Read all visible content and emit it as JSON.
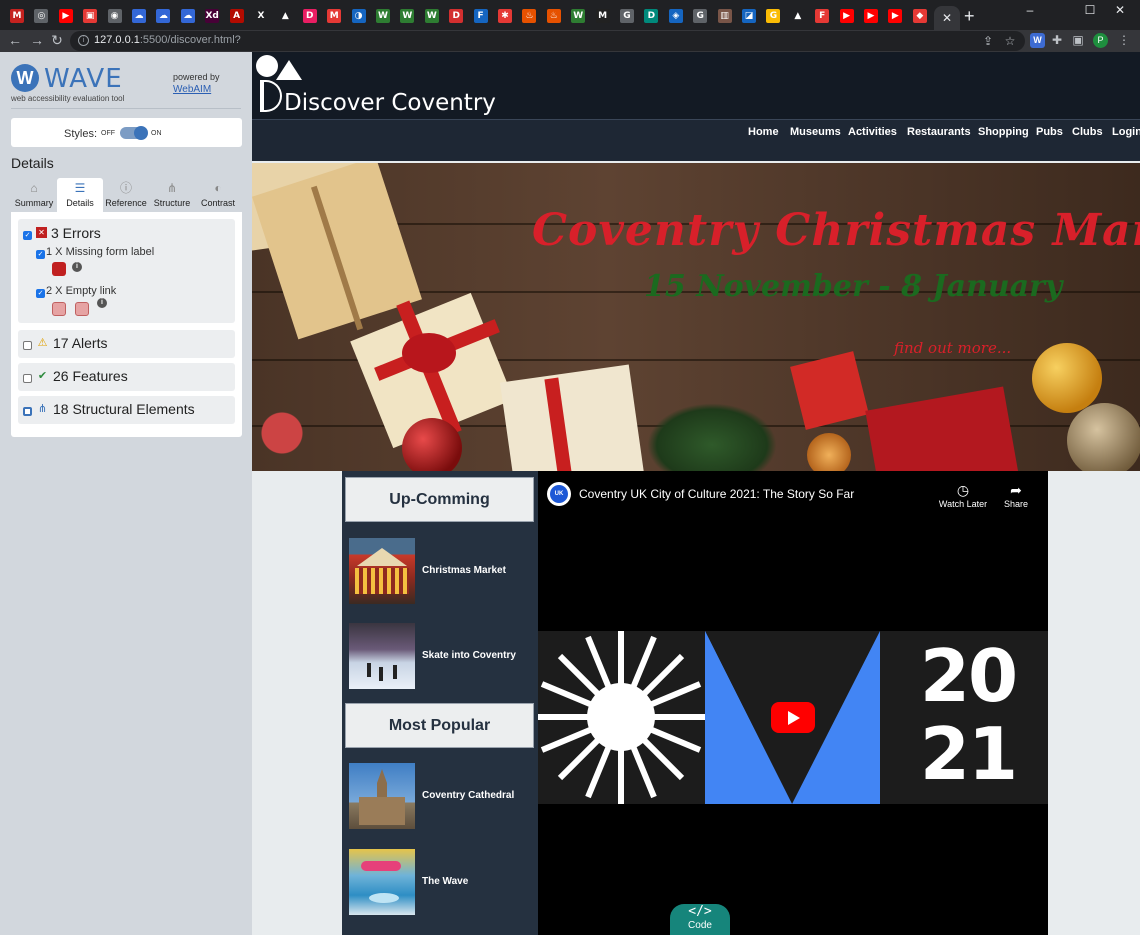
{
  "browser": {
    "url_host": "127.0.0.1",
    "url_path": ":5500/discover.html?",
    "tab_favicons": [
      {
        "glyph": "M",
        "color": "#c5221f"
      },
      {
        "glyph": "◎",
        "color": "#5f6368"
      },
      {
        "glyph": "▶",
        "color": "#ff0000"
      },
      {
        "glyph": "▣",
        "color": "#e53935"
      },
      {
        "glyph": "◉",
        "color": "#5f6368"
      },
      {
        "glyph": "☁",
        "color": "#3367d6"
      },
      {
        "glyph": "☁",
        "color": "#3367d6"
      },
      {
        "glyph": "☁",
        "color": "#3367d6"
      },
      {
        "glyph": "Xd",
        "color": "#470137"
      },
      {
        "glyph": "A",
        "color": "#b30b00"
      },
      {
        "glyph": "X",
        "color": "#202124"
      },
      {
        "glyph": "▲",
        "color": "#202124"
      },
      {
        "glyph": "D",
        "color": "#e91e63"
      },
      {
        "glyph": "M",
        "color": "#e53935"
      },
      {
        "glyph": "◑",
        "color": "#1565c0"
      },
      {
        "glyph": "W",
        "color": "#2e7d32"
      },
      {
        "glyph": "W",
        "color": "#2e7d32"
      },
      {
        "glyph": "W",
        "color": "#2e7d32"
      },
      {
        "glyph": "D",
        "color": "#d32f2f"
      },
      {
        "glyph": "F",
        "color": "#1565c0"
      },
      {
        "glyph": "✱",
        "color": "#e53935"
      },
      {
        "glyph": "♨",
        "color": "#e65100"
      },
      {
        "glyph": "♨",
        "color": "#e65100"
      },
      {
        "glyph": "W",
        "color": "#2e7d32"
      },
      {
        "glyph": "M",
        "color": "#212121"
      },
      {
        "glyph": "G",
        "color": "#5f6368"
      },
      {
        "glyph": "D",
        "color": "#00897b"
      },
      {
        "glyph": "◈",
        "color": "#1565c0"
      },
      {
        "glyph": "G",
        "color": "#5f6368"
      },
      {
        "glyph": "▥",
        "color": "#795548"
      },
      {
        "glyph": "◪",
        "color": "#1565c0"
      },
      {
        "glyph": "G",
        "color": "#fbbc05"
      },
      {
        "glyph": "▲",
        "color": "#202124"
      },
      {
        "glyph": "F",
        "color": "#e53935"
      },
      {
        "glyph": "▶",
        "color": "#ff0000"
      },
      {
        "glyph": "▶",
        "color": "#ff0000"
      },
      {
        "glyph": "▶",
        "color": "#ff0000"
      },
      {
        "glyph": "◆",
        "color": "#e53935"
      },
      {
        "glyph": "▣",
        "color": "#5f6368"
      }
    ],
    "new_tab": "+",
    "minimize": "–",
    "maximize": "☐",
    "close": "✕",
    "ext_label": "W",
    "profile_initial": "P"
  },
  "wave": {
    "title": "WAVE",
    "subtitle": "web accessibility evaluation tool",
    "powered_by": "powered by",
    "webaim": "WebAIM",
    "styles_label": "Styles:",
    "off": "OFF",
    "on": "ON",
    "details_heading": "Details",
    "tabs": [
      {
        "label": "Summary",
        "icon": "home-icon",
        "glyph": "⌂"
      },
      {
        "label": "Details",
        "icon": "list-icon",
        "glyph": "☰"
      },
      {
        "label": "Reference",
        "icon": "info-icon",
        "glyph": "ⓘ"
      },
      {
        "label": "Structure",
        "icon": "structure-icon",
        "glyph": "⋔"
      },
      {
        "label": "Contrast",
        "icon": "contrast-icon",
        "glyph": "◐"
      }
    ],
    "errors_label": "3 Errors",
    "error_items": [
      "1 X Missing form label",
      "2 X Empty link"
    ],
    "categories": [
      {
        "label": "17 Alerts",
        "icon": "alert-icon",
        "glyph": "⚠",
        "color": "#e0a000"
      },
      {
        "label": "26 Features",
        "icon": "feature-icon",
        "glyph": "✔",
        "color": "#2e8b3e"
      },
      {
        "label": "18 Structural Elements",
        "icon": "structure-icon",
        "glyph": "⋔",
        "color": "#3b73b9"
      }
    ]
  },
  "site": {
    "title": "Discover Coventry",
    "nav": [
      "Home",
      "Museums",
      "Activities",
      "Restaurants",
      "Shopping",
      "Pubs",
      "Clubs",
      "Login"
    ],
    "hero_title": "Coventry Christmas Market",
    "hero_dates": "15 November - 8 January",
    "hero_link": "find out more...",
    "sidebar": {
      "upcoming_heading": "Up-Comming",
      "upcoming": [
        "Christmas Market",
        "Skate into Coventry"
      ],
      "popular_heading": "Most Popular",
      "popular": [
        "Coventry Cathedral",
        "The Wave"
      ]
    },
    "video": {
      "channel": "UK",
      "title": "Coventry UK City of Culture 2021: The Story So Far",
      "watch_later": "Watch Later",
      "share": "Share",
      "year_top": "20",
      "year_bottom": "21"
    },
    "code_button": "Code"
  }
}
